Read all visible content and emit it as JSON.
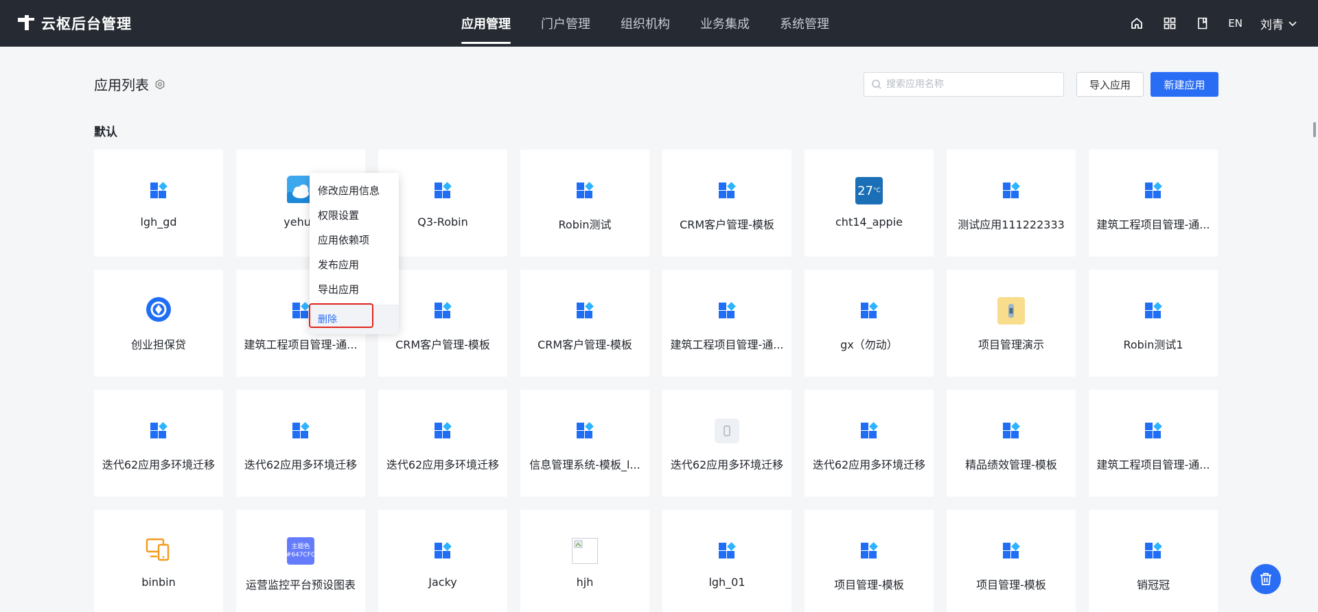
{
  "app": {
    "title": "云枢后台管理"
  },
  "nav": {
    "items": [
      {
        "label": "应用管理"
      },
      {
        "label": "门户管理"
      },
      {
        "label": "组织机构"
      },
      {
        "label": "业务集成"
      },
      {
        "label": "系统管理"
      }
    ],
    "active": "应用管理"
  },
  "header": {
    "lang": "EN",
    "user": "刘青",
    "icons": [
      "home-icon",
      "apps-grid-icon",
      "book-icon",
      "chevron-down-icon"
    ]
  },
  "page": {
    "title": "应用列表",
    "search_placeholder": "搜索应用名称",
    "import_label": "导入应用",
    "new_label": "新建应用",
    "group": "默认"
  },
  "apps": [
    {
      "name": "lgh_gd",
      "icon": "grid"
    },
    {
      "name": "yehua",
      "icon": "cloud"
    },
    {
      "name": "Q3-Robin",
      "icon": "grid"
    },
    {
      "name": "Robin测试",
      "icon": "grid"
    },
    {
      "name": "CRM客户管理-模板",
      "icon": "grid"
    },
    {
      "name": "cht14_appie",
      "icon": "weather",
      "icon_text": "27",
      "icon_unit": "°C"
    },
    {
      "name": "测试应用111222333",
      "icon": "grid"
    },
    {
      "name": "建筑工程项目管理-通...",
      "icon": "grid"
    },
    {
      "name": "创业担保贷",
      "icon": "circle"
    },
    {
      "name": "建筑工程项目管理-通...",
      "icon": "grid"
    },
    {
      "name": "CRM客户管理-模板",
      "icon": "grid"
    },
    {
      "name": "CRM客户管理-模板",
      "icon": "grid"
    },
    {
      "name": "建筑工程项目管理-通...",
      "icon": "grid"
    },
    {
      "name": "gx（勿动）",
      "icon": "grid"
    },
    {
      "name": "项目管理演示",
      "icon": "yellow"
    },
    {
      "name": "Robin测试1",
      "icon": "grid"
    },
    {
      "name": "迭代62应用多环境迁移",
      "icon": "grid"
    },
    {
      "name": "迭代62应用多环境迁移",
      "icon": "grid"
    },
    {
      "name": "迭代62应用多环境迁移",
      "icon": "grid"
    },
    {
      "name": "信息管理系统-模板_l...",
      "icon": "grid"
    },
    {
      "name": "迭代62应用多环境迁移",
      "icon": "phone"
    },
    {
      "name": "迭代62应用多环境迁移",
      "icon": "grid"
    },
    {
      "name": "精品绩效管理-模板",
      "icon": "grid"
    },
    {
      "name": "建筑工程项目管理-通...",
      "icon": "grid"
    },
    {
      "name": "binbin",
      "icon": "orange"
    },
    {
      "name": "运营监控平台预设图表",
      "icon": "purple",
      "icon_text": "主题色 #647CFC"
    },
    {
      "name": "Jacky",
      "icon": "grid"
    },
    {
      "name": "hjh",
      "icon": "broken"
    },
    {
      "name": "lgh_01",
      "icon": "grid"
    },
    {
      "name": "项目管理-模板",
      "icon": "grid"
    },
    {
      "name": "项目管理-模板",
      "icon": "grid"
    },
    {
      "name": "销冠冠",
      "icon": "grid"
    }
  ],
  "context_menu": {
    "items": [
      "修改应用信息",
      "权限设置",
      "应用依赖项",
      "发布应用",
      "导出应用"
    ],
    "danger": "删除"
  },
  "colors": {
    "primary": "#2a6df5",
    "topbar": "#262b33",
    "highlight": "#e0241e"
  }
}
